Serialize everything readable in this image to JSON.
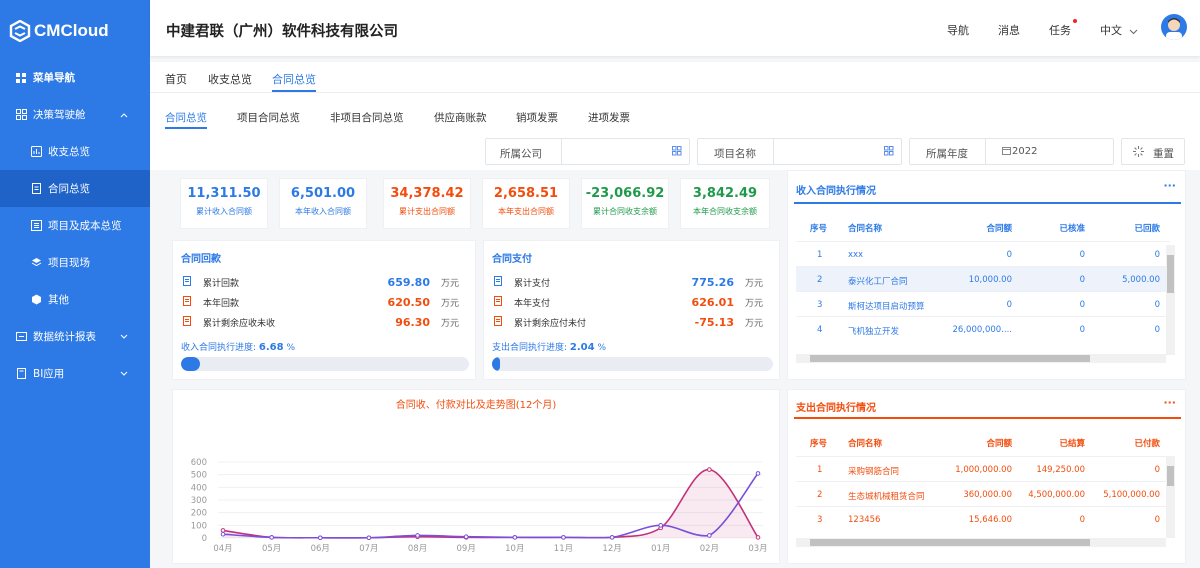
{
  "app": {
    "logo_text": "CMCloud"
  },
  "sidebar": {
    "items": [
      {
        "label": "菜单导航",
        "icon": "grid-icon"
      },
      {
        "label": "决策驾驶舱",
        "icon": "dashboard-icon"
      },
      {
        "label": "收支总览",
        "icon": "chart-icon"
      },
      {
        "label": "合同总览",
        "icon": "document-icon"
      },
      {
        "label": "项目及成本总览",
        "icon": "list-icon"
      },
      {
        "label": "项目现场",
        "icon": "layers-icon"
      },
      {
        "label": "其他",
        "icon": "box-icon"
      },
      {
        "label": "数据统计报表",
        "icon": "report-icon"
      },
      {
        "label": "BI应用",
        "icon": "bi-icon"
      }
    ]
  },
  "header": {
    "company": "中建君联（广州）软件科技有限公司",
    "nav": "导航",
    "messages": "消息",
    "tasks": "任务",
    "language": "中文"
  },
  "tabs_top": [
    "首页",
    "收支总览",
    "合同总览"
  ],
  "tabs_sub": [
    "合同总览",
    "项目合同总览",
    "非项目合同总览",
    "供应商账款",
    "销项发票",
    "进项发票"
  ],
  "filters": {
    "company_label": "所属公司",
    "project_label": "项目名称",
    "year_label": "所属年度",
    "year_value": "2022",
    "reset": "重置"
  },
  "stats": [
    {
      "value": "11,311.50",
      "label": "累计收入合同额",
      "color": "#2d7ae6"
    },
    {
      "value": "6,501.00",
      "label": "本年收入合同额",
      "color": "#2d7ae6"
    },
    {
      "value": "34,378.42",
      "label": "累计支出合同额",
      "color": "#f24d0e"
    },
    {
      "value": "2,658.51",
      "label": "本年支出合同额",
      "color": "#f24d0e"
    },
    {
      "value": "-23,066.92",
      "label": "累计合同收支余额",
      "color": "#1f9a4a"
    },
    {
      "value": "3,842.49",
      "label": "本年合同收支余额",
      "color": "#1f9a4a"
    }
  ],
  "receipt": {
    "title": "合同回款",
    "rows": [
      {
        "name": "累计回款",
        "value": "659.80",
        "unit": "万元"
      },
      {
        "name": "本年回款",
        "value": "620.50",
        "unit": "万元"
      },
      {
        "name": "累计剩余应收未收",
        "value": "96.30",
        "unit": "万元"
      }
    ],
    "progress_label": "收入合同执行进度:",
    "progress_value": "6.68",
    "progress_unit": "%",
    "progress_fraction": 0.0668
  },
  "payment": {
    "title": "合同支付",
    "rows": [
      {
        "name": "累计支付",
        "value": "775.26",
        "unit": "万元"
      },
      {
        "name": "本年支付",
        "value": "626.01",
        "unit": "万元"
      },
      {
        "name": "累计剩余应付未付",
        "value": "-75.13",
        "unit": "万元"
      }
    ],
    "progress_label": "支出合同执行进度:",
    "progress_value": "2.04",
    "progress_unit": "%",
    "progress_fraction": 0.0204
  },
  "income_table": {
    "title": "收入合同执行情况",
    "more": "···",
    "headers": [
      "序号",
      "合同名称",
      "合同额",
      "已核准",
      "已回款"
    ],
    "rows": [
      [
        "1",
        "xxx",
        "0",
        "0",
        "0"
      ],
      [
        "2",
        "泰兴化工厂合同",
        "10,000.00",
        "0",
        "5,000.00"
      ],
      [
        "3",
        "斯柯达项目启动预算",
        "0",
        "0",
        "0"
      ],
      [
        "4",
        "飞机独立开发",
        "26,000,000....",
        "0",
        "0"
      ]
    ]
  },
  "expense_table": {
    "title": "支出合同执行情况",
    "more": "···",
    "headers": [
      "序号",
      "合同名称",
      "合同额",
      "已结算",
      "已付款"
    ],
    "rows": [
      [
        "1",
        "采购钢筋合同",
        "1,000,000.00",
        "149,250.00",
        "0"
      ],
      [
        "2",
        "生态城机械租赁合同",
        "360,000.00",
        "4,500,000.00",
        "5,100,000.00"
      ],
      [
        "3",
        "123456",
        "15,646.00",
        "0",
        "0"
      ]
    ]
  },
  "chart_data": {
    "type": "line",
    "title": "合同收、付款对比及走势图(12个月)",
    "categories": [
      "04月",
      "05月",
      "06月",
      "07月",
      "08月",
      "09月",
      "10月",
      "11月",
      "12月",
      "01月",
      "02月",
      "03月"
    ],
    "ylim": [
      0,
      600
    ],
    "yticks": [
      0,
      100,
      200,
      300,
      400,
      500,
      600
    ],
    "grid": true,
    "series": [
      {
        "color": "#c2317a",
        "area": true,
        "values": [
          60,
          5,
          2,
          2,
          10,
          5,
          5,
          5,
          5,
          80,
          540,
          5
        ]
      },
      {
        "color": "#7a4fd9",
        "area": false,
        "values": [
          30,
          5,
          2,
          2,
          20,
          10,
          5,
          5,
          5,
          100,
          20,
          510
        ]
      }
    ]
  }
}
